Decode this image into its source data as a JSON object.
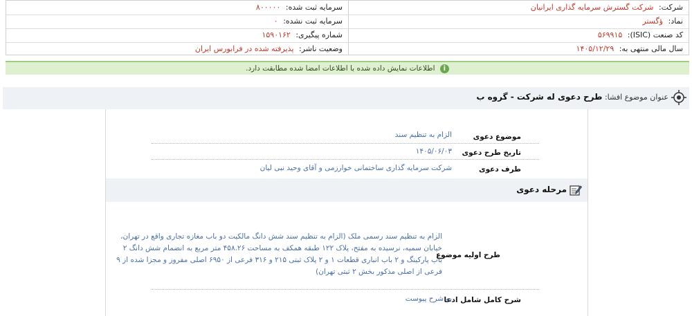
{
  "info": {
    "company_label": "شرکت:",
    "company_value": "شرکت گسترش سرمایه گذاری ایرانیان",
    "registered_capital_label": "سرمایه ثبت شده:",
    "registered_capital_value": "۸۰۰۰۰۰",
    "symbol_label": "نماد:",
    "symbol_value": "ؤگستر",
    "unregistered_capital_label": "سرمایه ثبت نشده:",
    "unregistered_capital_value": "۰",
    "isic_label": "کد صنعت (ISIC):",
    "isic_value": "۵۶۹۹۱۵",
    "tracking_label": "شماره پیگیری:",
    "tracking_value": "۱۵۹۰۱۶۲",
    "fiscal_label": "سال مالی منتهی به:",
    "fiscal_value": "۱۴۰۵/۱۲/۲۹",
    "publisher_label": "وضعیت ناشر:",
    "publisher_value": "پذیرفته شده در فرابورس ایران"
  },
  "notice": {
    "text": "اطلاعات نمایش داده شده با اطلاعات امضا شده مطابقت دارد."
  },
  "subject": {
    "label": "عنوان موضوع افشا:",
    "title": "طرح دعوی له شرکت - گروه ب"
  },
  "fields": {
    "claim_subject_label": "موضوع دعوی",
    "claim_subject_value": "الزام به تنظیم سند",
    "claim_date_label": "تاریخ طرح دعوی",
    "claim_date_value": "۱۴۰۵/۰۶/۰۳",
    "party_label": "طرف دعوی",
    "party_value": "شرکت سرمایه گذاری ساختمانی خوارزمی و آقای وحید نبی لیان"
  },
  "stage": {
    "title": "مرحله دعوی"
  },
  "initial_subject": {
    "label": "طرح اولیه موضوع",
    "text": "الزام به تنظیم سند رسمی ملک (الزام به تنظیم سند شش دانگ مالکیت دو باب مغازه تجاری واقع در تهران، خیابان سمیه، نرسیده به مفتح، پلاک ۱۲۲ طبقه همکف به مساحت ۴۵۸.۲۶ متر مربع به انضمام شش دانگ ۲ باب پارکینگ و ۲ باب انباری قطعات ۱ و ۲ پلاک ثبتی ۲۱۵ و ۳۱۶ فرعی از ۶۹۵۰ اصلی مفروز و مجزا شده از ۹ فرعی از اصلی مذکور بخش ۲ ثبتی تهران)"
  },
  "full_description": {
    "label": "شرح کامل شامل ادعا",
    "value": "به شرح پیوست"
  },
  "colors": {
    "value_red": "#c0392b",
    "value_blue": "#4a6fa5",
    "notice_bg": "#dff0d0",
    "notice_border": "#9bcf7b",
    "strip_bg": "#eef2f6"
  },
  "icons": {
    "notice": "info-circle-icon",
    "subject": "target-icon",
    "stage": "edit-document-icon"
  }
}
